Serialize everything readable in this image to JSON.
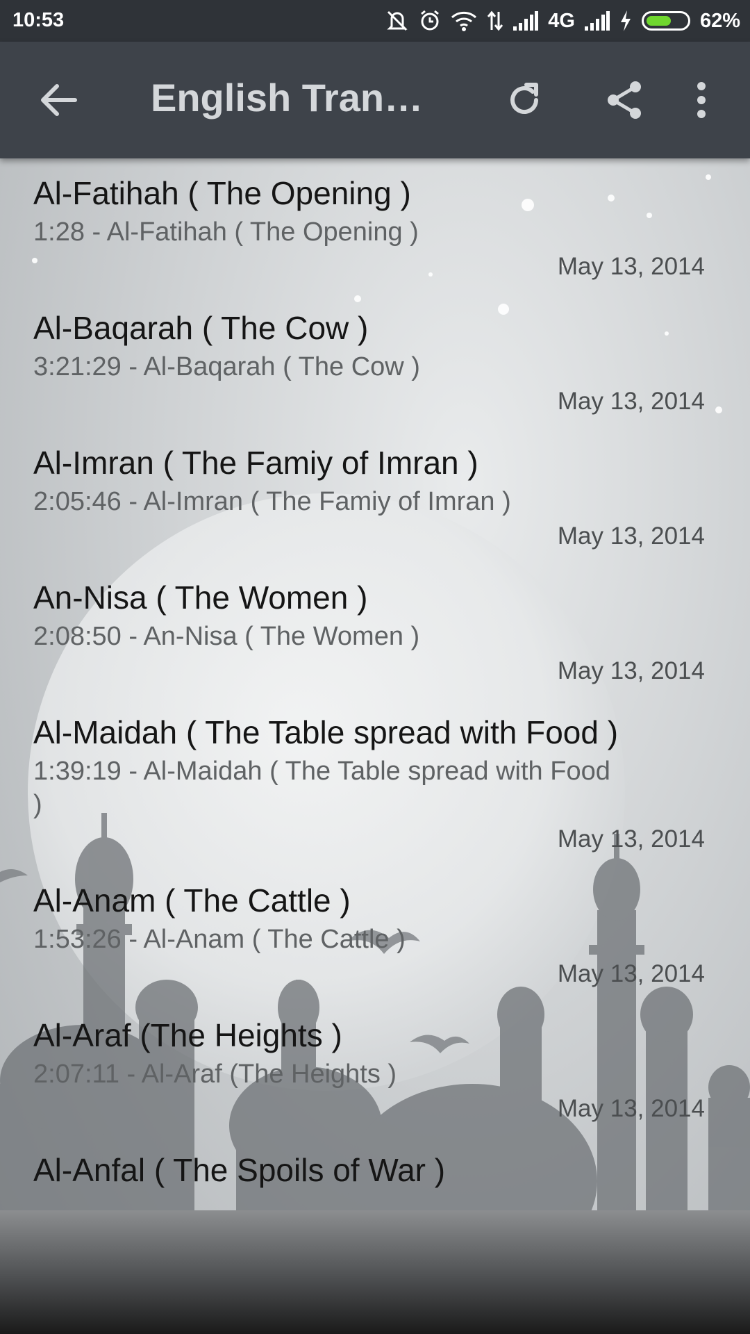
{
  "status_bar": {
    "time": "10:53",
    "network": "4G",
    "battery_percent": "62%",
    "battery_level": 0.62,
    "icons": [
      "mute-icon",
      "alarm-icon",
      "wifi-icon",
      "data-arrows-icon",
      "signal-icon",
      "signal-icon",
      "charging-icon",
      "battery-icon"
    ]
  },
  "app_bar": {
    "title": "English Transl...",
    "back_icon": "arrow-left-icon",
    "refresh_icon": "refresh-icon",
    "share_icon": "share-icon",
    "menu_icon": "more-vert-icon",
    "background": "#3e434a"
  },
  "list": {
    "items": [
      {
        "title": "Al-Fatihah ( The Opening )",
        "subtitle": "1:28 - Al-Fatihah ( The Opening )",
        "date": "May 13, 2014"
      },
      {
        "title": "Al-Baqarah ( The Cow )",
        "subtitle": "3:21:29 - Al-Baqarah ( The Cow )",
        "date": "May 13, 2014"
      },
      {
        "title": "Al-Imran ( The Famiy of Imran )",
        "subtitle": "2:05:46 - Al-Imran ( The Famiy of Imran )",
        "date": "May 13, 2014"
      },
      {
        "title": "An-Nisa ( The Women )",
        "subtitle": "2:08:50 - An-Nisa ( The Women )",
        "date": "May 13, 2014"
      },
      {
        "title": "Al-Maidah ( The Table spread with Food )",
        "subtitle": "1:39:19 - Al-Maidah ( The Table spread with Food )",
        "date": "May 13, 2014"
      },
      {
        "title": "Al-Anam ( The Cattle )",
        "subtitle": "1:53:26 - Al-Anam ( The Cattle )",
        "date": "May 13, 2014"
      },
      {
        "title": "Al-Araf (The Heights )",
        "subtitle": "2:07:11 - Al-Araf (The Heights )",
        "date": "May 13, 2014"
      },
      {
        "title": "Al-Anfal ( The Spoils of War )",
        "subtitle": "",
        "date": ""
      }
    ]
  },
  "colors": {
    "status_bar": "#2f3338",
    "title_text": "#151515",
    "subtitle_text": "#5f6264",
    "date_text": "#4b4e50",
    "battery_fill": "#6fd62e"
  }
}
